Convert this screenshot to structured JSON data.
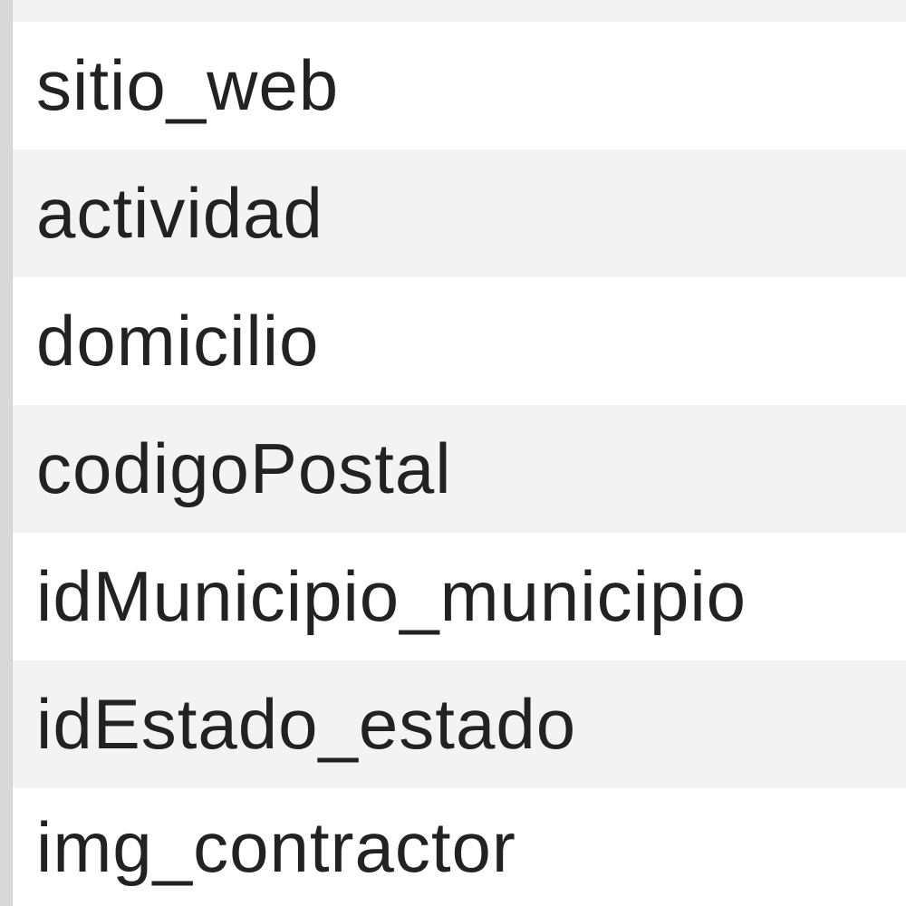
{
  "list": {
    "items": [
      {
        "label": "sitio_web"
      },
      {
        "label": "actividad"
      },
      {
        "label": "domicilio"
      },
      {
        "label": "codigoPostal"
      },
      {
        "label": "idMunicipio_municipio"
      },
      {
        "label": "idEstado_estado"
      },
      {
        "label": "img_contractor"
      }
    ]
  },
  "colors": {
    "row_alt": "#f3f3f3",
    "row_plain": "#ffffff",
    "text": "#222222",
    "left_border": "#d9d9d9"
  }
}
